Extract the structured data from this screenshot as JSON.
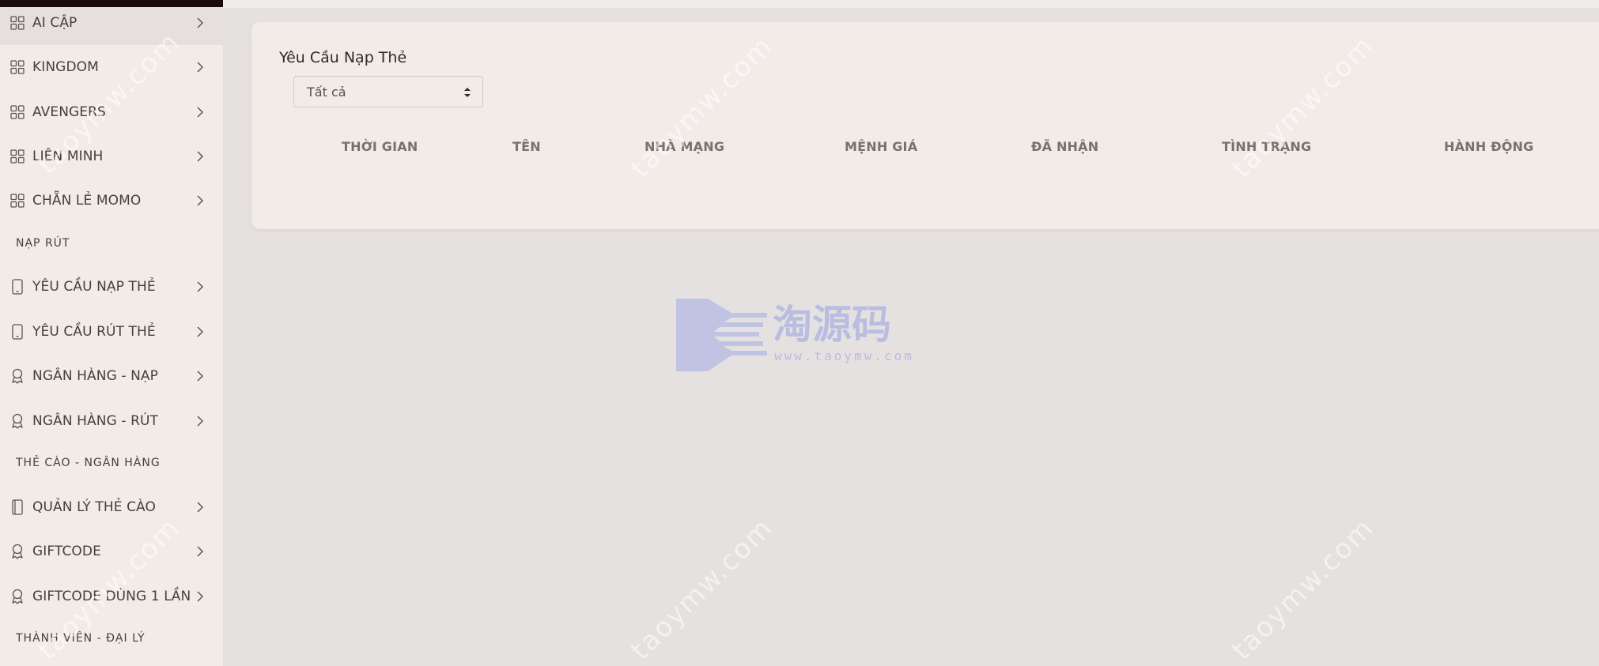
{
  "sidebar": {
    "items": [
      {
        "label": "AI CẬP",
        "icon": "grid-icon"
      },
      {
        "label": "KINGDOM",
        "icon": "grid-icon"
      },
      {
        "label": "AVENGERS",
        "icon": "grid-icon"
      },
      {
        "label": "LIÊN MINH",
        "icon": "grid-icon"
      },
      {
        "label": "CHẴN LẺ MOMO",
        "icon": "grid-icon"
      }
    ],
    "section_nap_rut": "NẠP RÚT",
    "items2": [
      {
        "label": "YÊU CẦU NẠP THẺ",
        "icon": "mobile-icon"
      },
      {
        "label": "YÊU CẦU RÚT THẺ",
        "icon": "mobile-icon"
      },
      {
        "label": "NGÂN HÀNG - NẠP",
        "icon": "award-icon"
      },
      {
        "label": "NGÂN HÀNG - RÚT",
        "icon": "award-icon"
      }
    ],
    "section_the_cao": "THẺ CÀO - NGÂN HÀNG",
    "items3": [
      {
        "label": "QUẢN LÝ THẺ CÀO",
        "icon": "book-icon"
      },
      {
        "label": "GIFTCODE",
        "icon": "award-icon"
      },
      {
        "label": "GIFTCODE DÙNG 1 LẦN",
        "icon": "award-icon"
      }
    ],
    "section_thanh_vien": "THÀNH VIÊN - ĐẠI LÝ"
  },
  "main": {
    "title": "Yêu Cầu Nạp Thẻ",
    "filter_value": "Tất cả",
    "columns": [
      "THỜI GIAN",
      "TÊN",
      "NHÀ MẠNG",
      "MỆNH GIÁ",
      "ĐÃ NHẬN",
      "TÌNH TRẠNG",
      "HÀNH ĐỘNG"
    ]
  },
  "watermark": {
    "text": "taoymw.com",
    "logo_chars": "淘源码",
    "logo_url": "www.taoymw.com"
  },
  "colors": {
    "sidebar_bg": "#f3ebe7",
    "page_bg": "#e6e1e1",
    "card_bg": "#f3ebe8",
    "watermark_logo": "#b9bde0"
  }
}
